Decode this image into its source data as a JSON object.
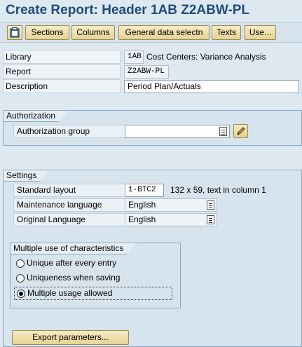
{
  "title": "Create Report: Header    1AB Z2ABW-PL",
  "toolbar": {
    "icon": "clipboard-icon",
    "buttons": [
      "Sections",
      "Columns",
      "General data selectn",
      "Texts",
      "Use..."
    ]
  },
  "header_fields": {
    "library_label": "Library",
    "library_value": "1AB",
    "library_desc": "Cost Centers: Variance Analysis",
    "report_label": "Report",
    "report_value": "Z2ABW-PL",
    "description_label": "Description",
    "description_value": "Period Plan/Actuals"
  },
  "authorization": {
    "title": "Authorization",
    "group_label": "Authorization group",
    "group_value": ""
  },
  "settings": {
    "title": "Settings",
    "standard_layout_label": "Standard layout",
    "standard_layout_value": "1-BTC2",
    "standard_layout_info": "132 x 59, text in column 1",
    "maintenance_language_label": "Maintenance language",
    "maintenance_language_value": "English",
    "original_language_label": "Original Language",
    "original_language_value": "English"
  },
  "characteristics": {
    "title": "Multiple use of characteristics",
    "options": [
      {
        "label": "Unique after every entry",
        "selected": false
      },
      {
        "label": "Uniqueness when saving",
        "selected": false
      },
      {
        "label": "Multiple usage allowed",
        "selected": true
      }
    ]
  },
  "export_button": "Export parameters..."
}
